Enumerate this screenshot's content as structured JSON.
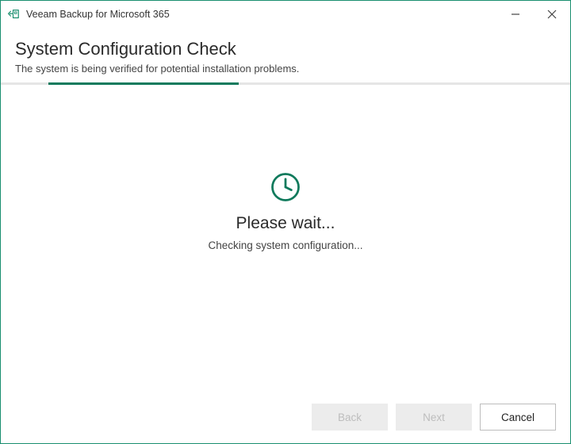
{
  "titlebar": {
    "app_name": "Veeam Backup for Microsoft 365"
  },
  "header": {
    "title": "System Configuration Check",
    "subtitle": "The system is being verified for potential installation problems."
  },
  "content": {
    "wait_title": "Please wait...",
    "wait_subtitle": "Checking system configuration..."
  },
  "footer": {
    "back_label": "Back",
    "next_label": "Next",
    "cancel_label": "Cancel"
  },
  "colors": {
    "accent": "#1a8f6f"
  }
}
